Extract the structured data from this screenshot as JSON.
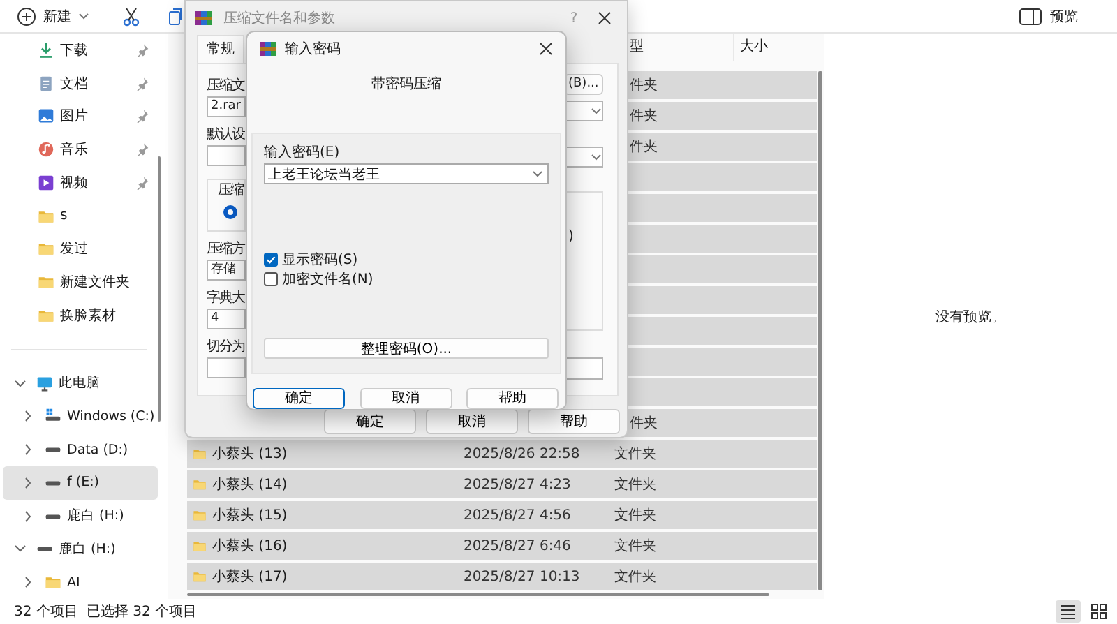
{
  "toolbar": {
    "new_label": "新建",
    "preview_label": "预览"
  },
  "sidebar": {
    "pinned_items": [
      {
        "label": "下载",
        "kind": "download",
        "pinned": true
      },
      {
        "label": "文档",
        "kind": "document",
        "pinned": true
      },
      {
        "label": "图片",
        "kind": "picture",
        "pinned": true
      },
      {
        "label": "音乐",
        "kind": "music",
        "pinned": true
      },
      {
        "label": "视频",
        "kind": "video",
        "pinned": true
      },
      {
        "label": "s",
        "kind": "folder",
        "pinned": false
      },
      {
        "label": "发过",
        "kind": "folder",
        "pinned": false
      },
      {
        "label": "新建文件夹",
        "kind": "folder",
        "pinned": false
      },
      {
        "label": "换脸素材",
        "kind": "folder",
        "pinned": false
      }
    ],
    "tree": [
      {
        "label": "此电脑",
        "kind": "computer",
        "expanded": true,
        "selected": false,
        "children": [
          {
            "label": "Windows (C:)",
            "kind": "system-drive",
            "expanded": false,
            "selected": false
          },
          {
            "label": "Data (D:)",
            "kind": "drive",
            "expanded": false,
            "selected": false
          },
          {
            "label": "f (E:)",
            "kind": "drive",
            "expanded": false,
            "selected": true
          },
          {
            "label": "鹿白 (H:)",
            "kind": "drive",
            "expanded": false,
            "selected": false
          }
        ]
      },
      {
        "label": "鹿白 (H:)",
        "kind": "drive",
        "expanded": true,
        "selected": false,
        "children": [
          {
            "label": "AI",
            "kind": "folder",
            "expanded": false,
            "selected": false
          }
        ]
      }
    ]
  },
  "file_list": {
    "columns": [
      {
        "label": "型"
      },
      {
        "label": "大小"
      }
    ],
    "rows": [
      {
        "type": "件夹",
        "selected": true
      },
      {
        "type": "件夹",
        "selected": true
      },
      {
        "type": "件夹",
        "selected": true
      },
      {
        "selected": true
      },
      {
        "selected": true
      },
      {
        "selected": true
      },
      {
        "selected": true
      },
      {
        "selected": true
      },
      {
        "selected": true
      },
      {
        "selected": true
      },
      {
        "selected": true
      },
      {
        "type": "件夹",
        "selected": true
      },
      {
        "name": "小蔡头 (13)",
        "modified": "2025/8/26 22:58",
        "type": "文件夹",
        "selected": true
      },
      {
        "name": "小蔡头 (14)",
        "modified": "2025/8/27 4:23",
        "type": "文件夹",
        "selected": true
      },
      {
        "name": "小蔡头 (15)",
        "modified": "2025/8/27 4:56",
        "type": "文件夹",
        "selected": true
      },
      {
        "name": "小蔡头 (16)",
        "modified": "2025/8/27 6:46",
        "type": "文件夹",
        "selected": true
      },
      {
        "name": "小蔡头 (17)",
        "modified": "2025/8/27 10:13",
        "type": "文件夹",
        "selected": true
      }
    ]
  },
  "preview_pane": {
    "message": "没有预览。"
  },
  "status_bar": {
    "item_count": "32 个项目",
    "selection_count": "已选择 32 个项目",
    "view_buttons": [
      {
        "kind": "details",
        "selected": true
      },
      {
        "kind": "tiles",
        "selected": false
      }
    ]
  },
  "archive_dialog": {
    "title": "压缩文件名和参数",
    "help": "?",
    "tabs": [
      {
        "label": "常规",
        "selected": true
      }
    ],
    "left_controls": [
      {
        "kind": "label",
        "text": "压缩文"
      },
      {
        "kind": "field",
        "value": "2.rar"
      },
      {
        "kind": "label",
        "text": "默认设"
      },
      {
        "kind": "field"
      },
      {
        "kind": "group",
        "label": "压缩",
        "option_selected": true
      },
      {
        "kind": "label",
        "text": "压缩方"
      },
      {
        "kind": "field",
        "value": "存储"
      },
      {
        "kind": "label",
        "text": "字典大"
      },
      {
        "kind": "field",
        "value": "4"
      },
      {
        "kind": "label",
        "text": "切分为"
      },
      {
        "kind": "field"
      }
    ],
    "right_controls": [
      {
        "kind": "button",
        "text": "(B)..."
      },
      {
        "kind": "combo"
      },
      {
        "kind": "combo"
      },
      {
        "kind": "group",
        "text": ")"
      },
      {
        "kind": "field"
      }
    ],
    "buttons": [
      {
        "label": "确定",
        "default": false
      },
      {
        "label": "取消",
        "default": false
      },
      {
        "label": "帮助",
        "default": false
      }
    ]
  },
  "password_dialog": {
    "title": "输入密码",
    "heading": "带密码压缩",
    "password_label": "输入密码(E)",
    "password_value": "上老王论坛当老王",
    "options": [
      {
        "label": "显示密码(S)",
        "checked": true
      },
      {
        "label": "加密文件名(N)",
        "checked": false
      }
    ],
    "organize_button": "整理密码(O)...",
    "buttons": [
      {
        "label": "确定",
        "default": true
      },
      {
        "label": "取消",
        "default": false
      },
      {
        "label": "帮助",
        "default": false
      }
    ]
  }
}
